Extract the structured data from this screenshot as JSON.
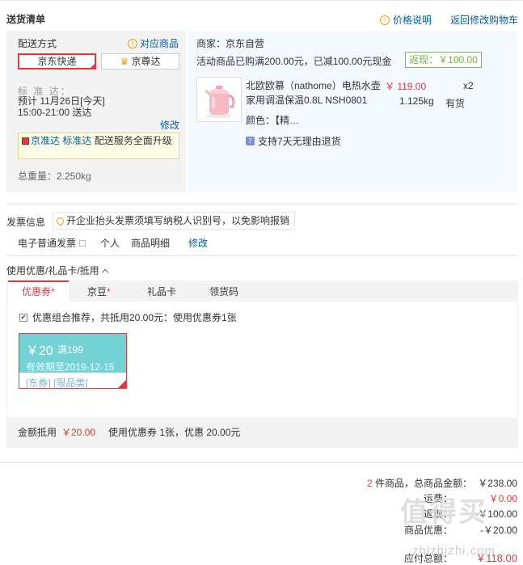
{
  "section_title": "送货清单",
  "header_links": {
    "price_explain": "价格说明",
    "back_to_cart": "返回修改购物车"
  },
  "shipping": {
    "method_label": "配送方式",
    "goods_link": "对应商品",
    "options": [
      "京东快递",
      "京尊达"
    ],
    "standard_label": "标 准 达：",
    "eta_text": "预计 11月26日[今天] 15:00-21:00 送达",
    "modify": "修改",
    "jzd_name": "京准达",
    "jzd_tag": "标准达",
    "jzd_text": "配送服务全面升级",
    "total_weight": "总重量：2.250kg"
  },
  "order": {
    "seller": "商家：京东自营",
    "promo": "活动商品已购满200.00元，已减100.00元现金",
    "cashback": "返现：￥100.00",
    "product_name": "北欧欧慕（nathome）电热水壶家用调温保温0.8L NSH0801",
    "price": "￥ 119.00",
    "qty": "x2",
    "weight": "1.125kg",
    "stock": "有货",
    "color": "颜色：【精…",
    "return_policy": "支持7天无理由退货"
  },
  "invoice": {
    "title": "发票信息",
    "tip": "开企业抬头发票须填写纳税人识别号，以免影响报销",
    "type": "电子普通发票",
    "person": "个人",
    "detail": "商品明细",
    "modify": "修改"
  },
  "coupon": {
    "title": "使用优惠/礼品卡/抵用",
    "tabs": [
      "优惠券",
      "京豆",
      "礼品卡",
      "领货码"
    ],
    "combo_text": "优惠组合推荐，共抵用20.00元：使用优惠券1张",
    "card_amount": "￥20",
    "card_condition": "满199",
    "card_valid": "有效期至2019-12-15",
    "card_tags": "[东券] [限品类]",
    "deduct_label": "金额抵用",
    "deduct_amount": "￥20.00",
    "deduct_desc": "使用优惠券 1张，优惠 20.00元"
  },
  "summary": {
    "count": "2",
    "count_label": "件商品，总商品金额：",
    "goods_total": "￥238.00",
    "freight_label": "运费：",
    "freight": "￥0.00",
    "cashback_label": "返现：",
    "cashback": "-￥100.00",
    "discount_label": "商品优惠：",
    "discount": "-￥20.00",
    "payable_label": "应付总额：",
    "payable": "￥118.00"
  },
  "watermark": {
    "main": "值得买",
    "domain": "zhizhizhi.com"
  },
  "colors": {
    "accent": "#e4393c",
    "link": "#005ea7",
    "coupon": "#74d2d4",
    "cashback": "#71b247"
  },
  "icons": [
    "info-icon",
    "kettle-image",
    "return-badge-icon",
    "pin-icon",
    "checkbox-icon"
  ]
}
